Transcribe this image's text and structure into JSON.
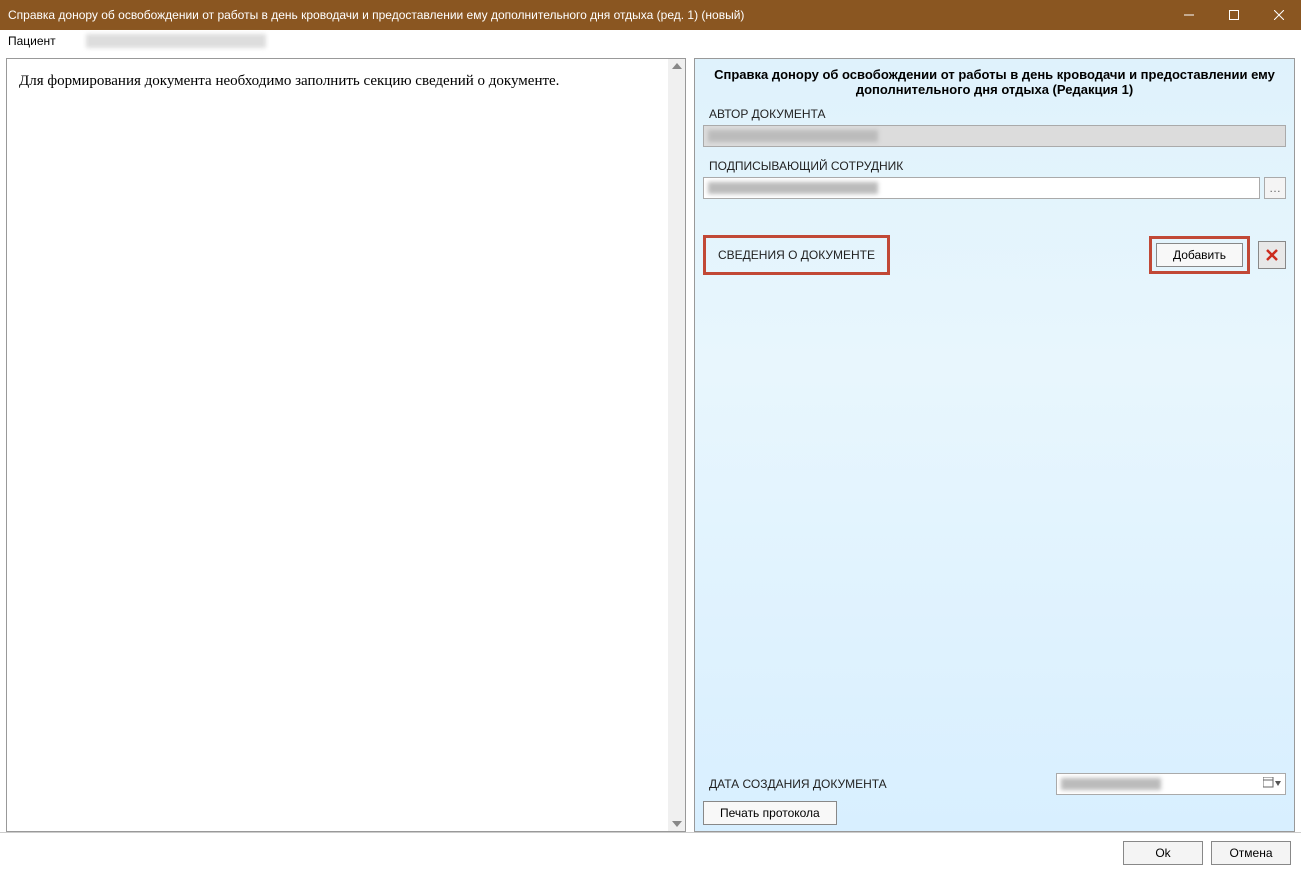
{
  "window": {
    "title": "Справка донору об освобождении от работы в день кроводачи и предоставлении ему дополнительного дня отдыха (ред. 1) (новый)"
  },
  "patient": {
    "label": "Пациент"
  },
  "left": {
    "message": "Для формирования документа необходимо заполнить секцию сведений о документе."
  },
  "right": {
    "title": "Справка донору об освобождении от работы в день кроводачи и предоставлении ему дополнительного дня отдыха (Редакция 1)",
    "author_label": "АВТОР ДОКУМЕНТА",
    "signer_label": "ПОДПИСЫВАЮЩИЙ СОТРУДНИК",
    "section_title": "СВЕДЕНИЯ О ДОКУМЕНТЕ",
    "add_label": "Добавить",
    "date_label": "ДАТА СОЗДАНИЯ ДОКУМЕНТА",
    "print_label": "Печать протокола",
    "ellipsis": "…"
  },
  "footer": {
    "ok": "Ok",
    "cancel": "Отмена"
  }
}
